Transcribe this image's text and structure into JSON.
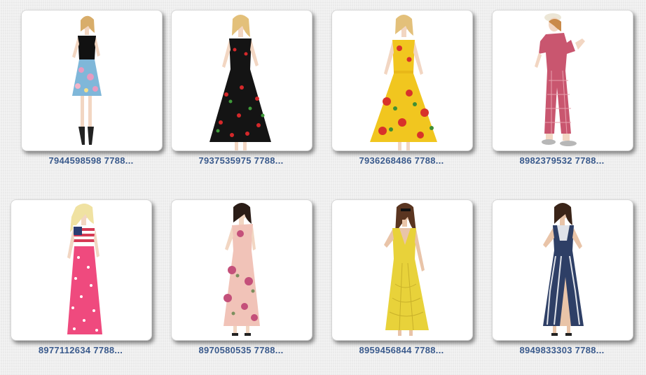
{
  "products": [
    {
      "id_label": "7944598598 7788...",
      "image_alt": "Black sleeveless top with blue floral A-line skirt dress",
      "colors": {
        "top": "#111111",
        "skirt": "#7fb7d9",
        "accent": "#e79ac0"
      }
    },
    {
      "id_label": "7937535975 7788...",
      "image_alt": "Black cherry print sleeveless swing dress",
      "colors": {
        "top": "#141414",
        "skirt": "#141414",
        "accent": "#d4282a"
      }
    },
    {
      "id_label": "7936268486 7788...",
      "image_alt": "Yellow rose print sleeveless swing dress",
      "colors": {
        "top": "#f1c61f",
        "skirt": "#f1c61f",
        "accent": "#d8322a"
      }
    },
    {
      "id_label": "8982379532 7788...",
      "image_alt": "Pink plaid short sleeve jumpsuit",
      "colors": {
        "top": "#c9566f",
        "skirt": "#c9566f",
        "accent": "#e8a0ad"
      }
    },
    {
      "id_label": "8977112634 7788...",
      "image_alt": "Stars and stripes pink maxi dress",
      "colors": {
        "top": "#ffffff",
        "skirt": "#ef4a7e",
        "accent": "#2c3e73"
      }
    },
    {
      "id_label": "8970580535 7788...",
      "image_alt": "Blush pink floral one-shoulder maxi dress",
      "colors": {
        "top": "#f1c3b8",
        "skirt": "#f1c3b8",
        "accent": "#c4507a"
      }
    },
    {
      "id_label": "8959456844 7788...",
      "image_alt": "Yellow V-neck chiffon maxi dress",
      "colors": {
        "top": "#e8d23a",
        "skirt": "#e8d23a",
        "accent": "#c9b12a"
      }
    },
    {
      "id_label": "8949833303 7788...",
      "image_alt": "Navy and white patterned lace maxi dress",
      "colors": {
        "top": "#2e3f66",
        "skirt": "#2e3f66",
        "accent": "#ffffff"
      }
    }
  ]
}
